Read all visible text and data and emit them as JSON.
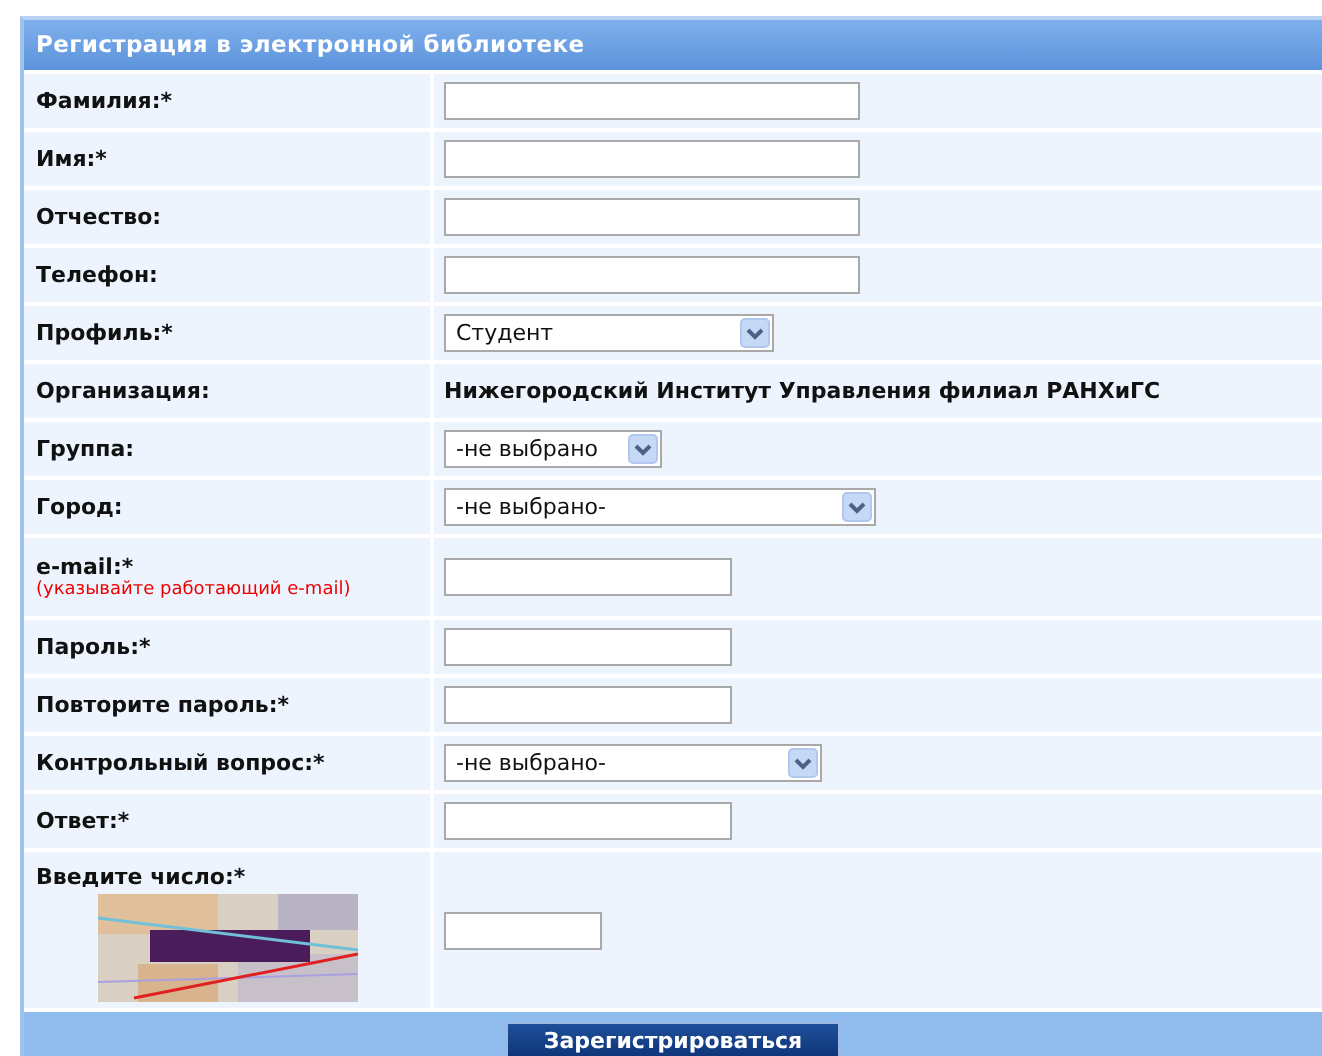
{
  "form": {
    "title": "Регистрация в электронной библиотеке",
    "rows": [
      {
        "kind": "text",
        "label": "Фамилия:*"
      },
      {
        "kind": "text",
        "label": "Имя:*"
      },
      {
        "kind": "text",
        "label": "Отчество:"
      },
      {
        "kind": "text",
        "label": "Телефон:"
      },
      {
        "kind": "select",
        "label": "Профиль:*",
        "value": "Студент"
      },
      {
        "kind": "static",
        "label": "Организация:",
        "value": "Нижегородский Институт Управления филиал РАНХиГС"
      },
      {
        "kind": "select",
        "label": "Группа:",
        "value": "-не выбрано"
      },
      {
        "kind": "select",
        "label": "Город:",
        "value": "-не выбрано-"
      },
      {
        "kind": "text",
        "label": "e-mail:*",
        "note": "(указывайте работающий e-mail)"
      },
      {
        "kind": "text",
        "label": "Пароль:*"
      },
      {
        "kind": "text",
        "label": "Повторите пароль:*"
      },
      {
        "kind": "select",
        "label": "Контрольный вопрос:*",
        "value": "-не выбрано-"
      },
      {
        "kind": "text",
        "label": "Ответ:*"
      },
      {
        "kind": "captcha",
        "label": "Введите число:*"
      }
    ],
    "submit": "Зарегистрироваться"
  }
}
